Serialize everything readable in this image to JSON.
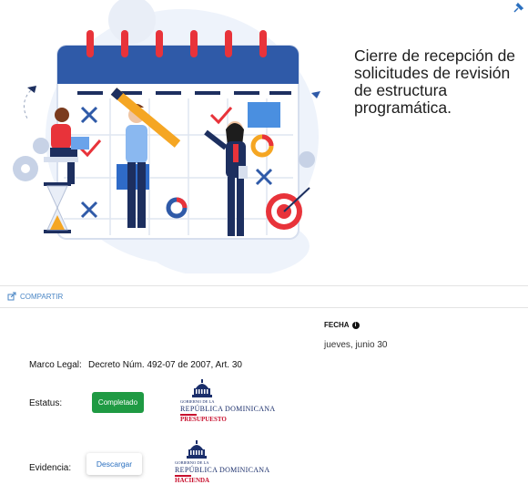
{
  "header": {
    "pin_icon": "pin-icon"
  },
  "hero": {
    "title": "Cierre de recepción de solicitudes de revisión de estructura programática."
  },
  "actions": {
    "share_label": "COMPARTIR"
  },
  "details": {
    "fecha_label": "FECHA",
    "fecha_info_glyph": "i",
    "fecha_value": "jueves, junio 30",
    "marco_label": "Marco Legal:",
    "marco_value": "Decreto Núm. 492-07 de 2007, Art. 30",
    "estatus_label": "Estatus:",
    "estatus_value": "Completado",
    "evidencia_label": "Evidencia:",
    "download_label": "Descargar"
  },
  "logos": [
    {
      "gob": "GOBIERNO DE LA",
      "rep": "REPÚBLICA DOMINICANA",
      "dept": "PRESUPUESTO"
    },
    {
      "gob": "GOBIERNO DE LA",
      "rep": "REPÚBLICA DOMINICANA",
      "dept": "HACIENDA"
    }
  ],
  "colors": {
    "accent": "#2a6fbf",
    "status_green": "#1f9a43",
    "brand_red": "#c8102e",
    "brand_navy": "#1a2e6b",
    "calendar_header": "#2f5aa8",
    "ring_red": "#e8333a"
  }
}
